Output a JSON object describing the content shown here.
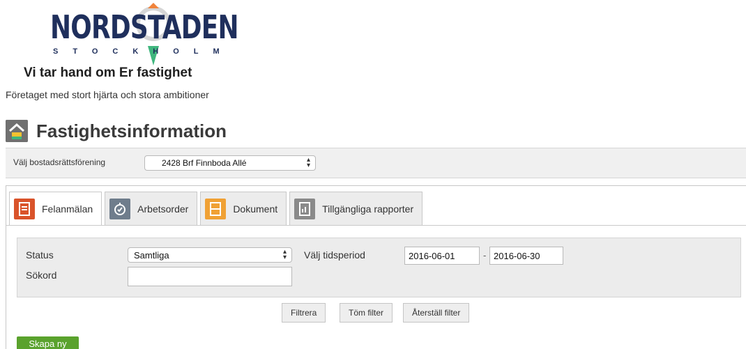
{
  "brand": {
    "logo_word": "NORDSTADEN",
    "logo_sub": "STOCKHOLM",
    "tagline": "Vi tar hand om Er fastighet",
    "subtagline": "Företaget med stort hjärta och stora ambitioner",
    "colors": {
      "navy": "#1f2f5c",
      "green": "#3fb67d",
      "orange": "#f0833c"
    }
  },
  "page": {
    "title": "Fastighetsinformation",
    "icon": "building-info-icon"
  },
  "association": {
    "label": "Välj bostadsrättsförening",
    "selected": "2428 Brf Finnboda Allé"
  },
  "tabs": [
    {
      "label": "Felanmälan",
      "icon": "clipboard-icon",
      "color": "#d9532a",
      "active": true
    },
    {
      "label": "Arbetsorder",
      "icon": "stopwatch-icon",
      "color": "#6f7d8c",
      "active": false
    },
    {
      "label": "Dokument",
      "icon": "filing-cabinet-icon",
      "color": "#f0a135",
      "active": false
    },
    {
      "label": "Tillgängliga rapporter",
      "icon": "report-icon",
      "color": "#8a8a8a",
      "active": false
    }
  ],
  "filters": {
    "status_label": "Status",
    "status_value": "Samtliga",
    "period_label": "Välj tidsperiod",
    "date_from": "2016-06-01",
    "date_separator": "-",
    "date_to": "2016-06-30",
    "keyword_label": "Sökord",
    "keyword_value": ""
  },
  "buttons": {
    "filter": "Filtrera",
    "clear": "Töm filter",
    "reset": "Återställ filter",
    "create": "Skapa ny"
  }
}
